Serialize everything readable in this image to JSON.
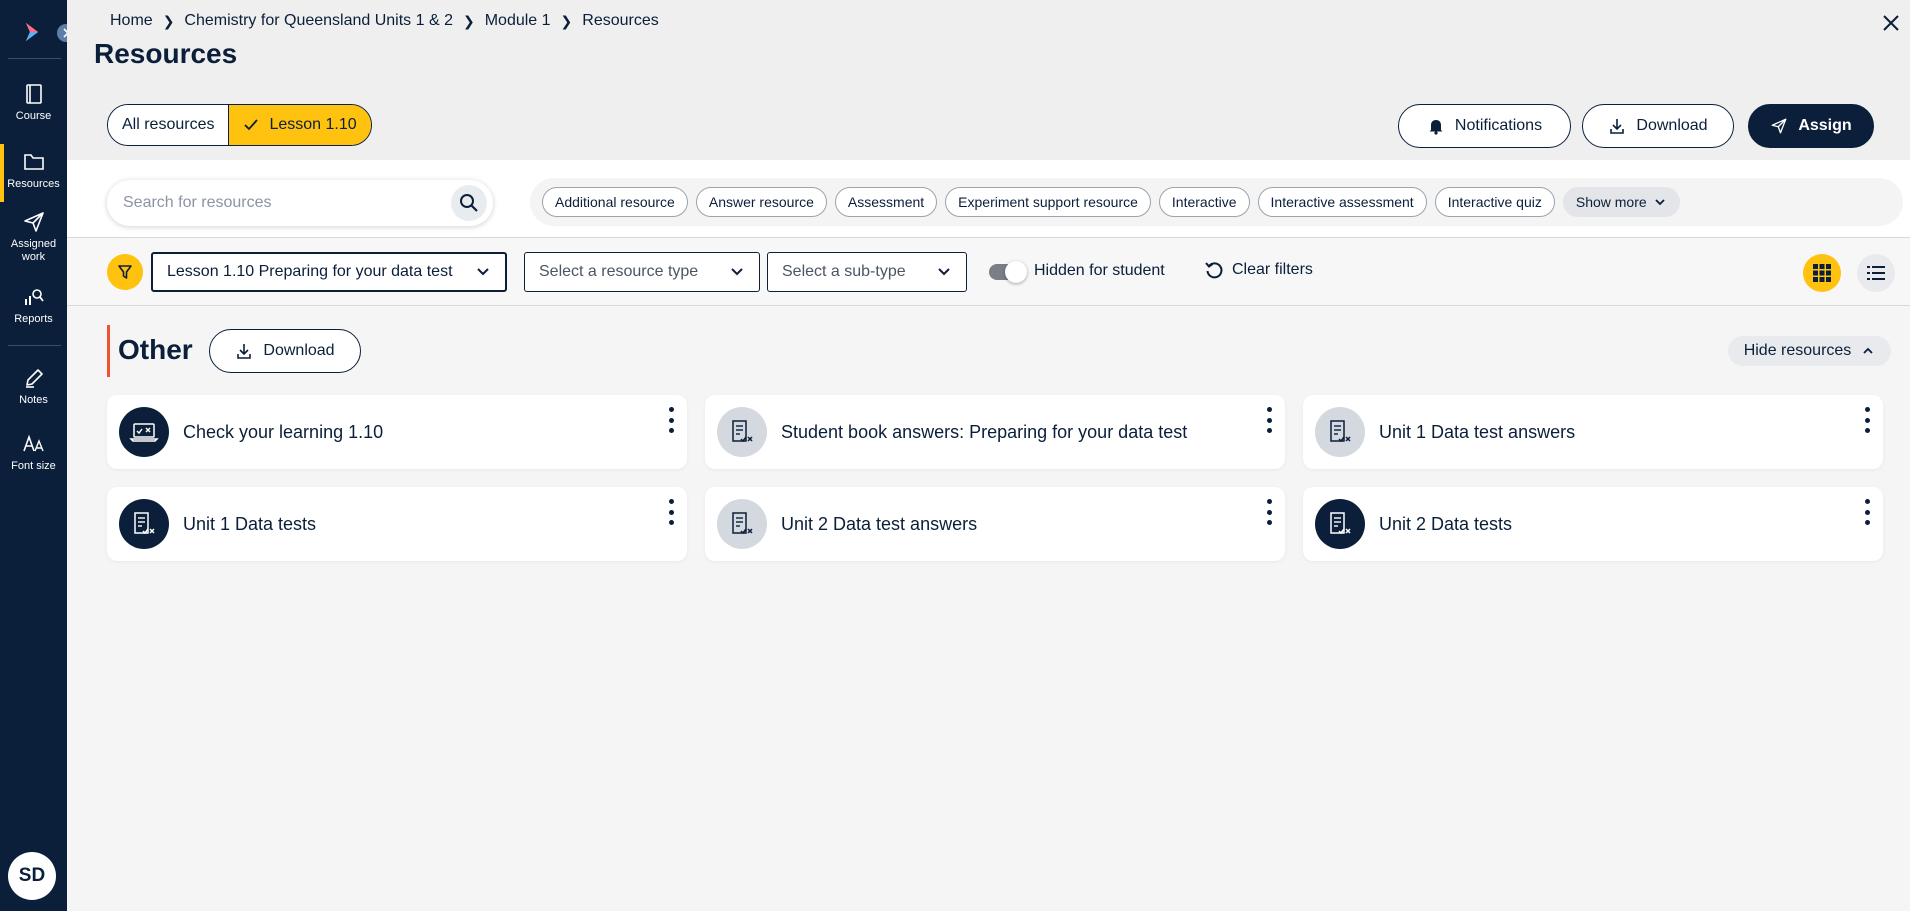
{
  "sidebar": {
    "items": [
      {
        "label": "Course"
      },
      {
        "label": "Resources"
      },
      {
        "label": "Assigned work"
      },
      {
        "label": "Reports"
      },
      {
        "label": "Notes"
      },
      {
        "label": "Font size"
      }
    ],
    "avatar": "SD"
  },
  "breadcrumb": [
    "Home",
    "Chemistry for Queensland Units 1 & 2",
    "Module 1",
    "Resources"
  ],
  "page_title": "Resources",
  "scope_toggle": {
    "all": "All resources",
    "lesson": "Lesson 1.10"
  },
  "header_buttons": {
    "notifications": "Notifications",
    "download": "Download",
    "assign": "Assign"
  },
  "search": {
    "placeholder": "Search for resources"
  },
  "tags": [
    "Additional resource",
    "Answer resource",
    "Assessment",
    "Experiment support resource",
    "Interactive",
    "Interactive assessment",
    "Interactive quiz"
  ],
  "show_more": "Show more",
  "filters": {
    "lesson": "Lesson 1.10 Preparing for your data test",
    "resource_type": "Select a resource type",
    "sub_type": "Select a sub-type",
    "hidden_label": "Hidden for student",
    "clear": "Clear filters"
  },
  "section": {
    "title": "Other",
    "download": "Download",
    "hide": "Hide resources"
  },
  "cards": [
    {
      "title": "Check your learning 1.10",
      "icon": "laptop-check-icon"
    },
    {
      "title": "Student book answers: Preparing for your data test",
      "icon": "answer-doc-icon"
    },
    {
      "title": "Unit 1 Data test answers",
      "icon": "answer-doc-icon"
    },
    {
      "title": "Unit 1 Data tests",
      "icon": "test-doc-icon"
    },
    {
      "title": "Unit 2 Data test answers",
      "icon": "answer-doc-icon"
    },
    {
      "title": "Unit 2 Data tests",
      "icon": "test-doc-icon"
    }
  ],
  "colors": {
    "navy": "#0b1f3a",
    "accent_yellow": "#ffc20e",
    "section_accent": "#f0532d"
  }
}
